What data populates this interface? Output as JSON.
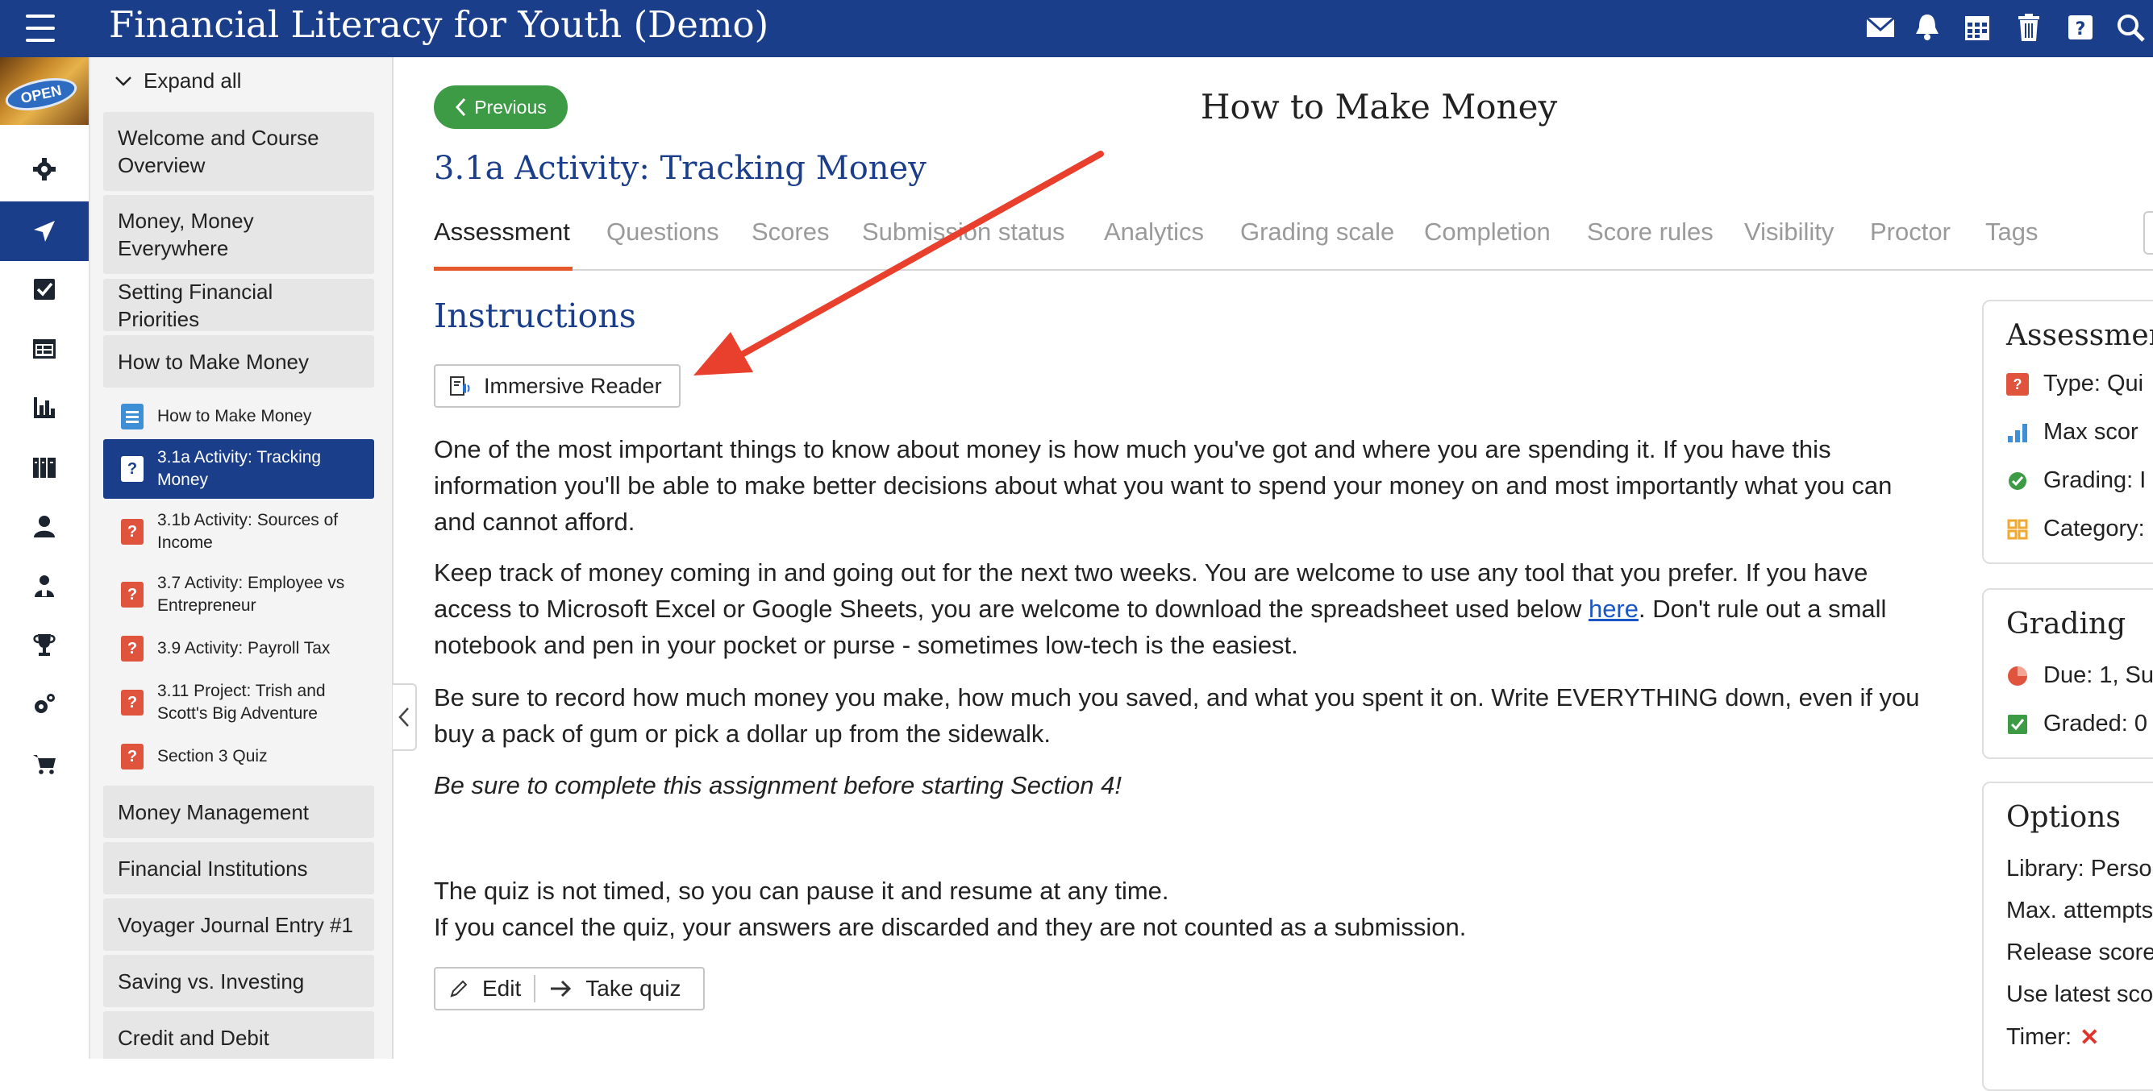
{
  "header": {
    "app_title": "Financial Literacy for Youth (Demo)",
    "icons": [
      "menu-icon",
      "mail-icon",
      "bell-icon",
      "calendar-icon",
      "trash-icon",
      "help-icon",
      "search-icon"
    ]
  },
  "rail": {
    "badge_text": "OPEN",
    "icons": [
      "gear-icon",
      "navigate-icon",
      "checklist-icon",
      "gradebook-icon",
      "analytics-icon",
      "library-icon",
      "person-icon",
      "people-icon",
      "trophy-icon",
      "settings-icon",
      "cart-icon"
    ]
  },
  "sidebar": {
    "expand_all": "Expand all",
    "sections_top": [
      "Welcome and Course Overview",
      "Money, Money Everywhere",
      "Setting Financial Priorities",
      "How to Make Money"
    ],
    "items": [
      "How to Make Money",
      "3.1a Activity: Tracking Money",
      "3.1b Activity: Sources of Income",
      "3.7 Activity: Employee vs Entrepreneur",
      "3.9 Activity: Payroll Tax",
      "3.11 Project: Trish and Scott's Big Adventure",
      "Section 3 Quiz"
    ],
    "sections_bottom": [
      "Money Management",
      "Financial Institutions",
      "Voyager Journal Entry #1",
      "Saving vs. Investing",
      "Credit and Debit"
    ]
  },
  "main": {
    "previous": "Previous",
    "page_title": "How to Make Money",
    "activity_title": "3.1a Activity: Tracking Money",
    "tabs": [
      "Assessment",
      "Questions",
      "Scores",
      "Submission status",
      "Analytics",
      "Grading scale",
      "Completion",
      "Score rules",
      "Visibility",
      "Proctor",
      "Tags"
    ],
    "instructions_heading": "Instructions",
    "immersive_reader": "Immersive Reader",
    "para1": "One of the most important things to know about money is how much you've got and where you are spending it. If you have this information you'll be able to make better decisions about what you want to spend your money on and most importantly what you can and cannot afford.",
    "para2_before": "Keep track of money coming in and going out for the next two weeks. You are welcome to use any tool that you prefer. If you have access to Microsoft Excel or Google Sheets, you are welcome to download the spreadsheet used below ",
    "para2_link": "here",
    "para2_after": ". Don't rule out a small notebook and pen in your pocket or purse - sometimes low-tech is the easiest.",
    "para3": "Be sure to record how much money you make, how much you saved, and what you spent it on. Write EVERYTHING down, even if you buy a pack of gum or pick a dollar up from the sidewalk.",
    "para4": "Be sure to complete this assignment before starting Section 4!",
    "quiz_note1": "The quiz is not timed, so you can pause it and resume at any time.",
    "quiz_note2": "If you cancel the quiz, your answers are discarded and they are not counted as a submission.",
    "edit": "Edit",
    "take_quiz": "Take quiz"
  },
  "right": {
    "assessment_h": "Assessmen",
    "type": "Type: Qui",
    "max_score": "Max scor",
    "grading": "Grading: I",
    "category": "Category:",
    "grading_h": "Grading",
    "due": "Due: 1, Su",
    "graded": "Graded: 0",
    "options_h": "Options",
    "library": "Library: Perso",
    "max_attempts": "Max. attempts",
    "release_score": "Release score",
    "use_latest": "Use latest sco",
    "timer": "Timer:",
    "timer_mark": "✕"
  },
  "colors": {
    "brand": "#1b3e8a",
    "accent_tab": "#e45a2a",
    "previous_button": "#3d9b46",
    "quiz_icon": "#e0533d",
    "annotation_arrow": "#e8402c"
  }
}
